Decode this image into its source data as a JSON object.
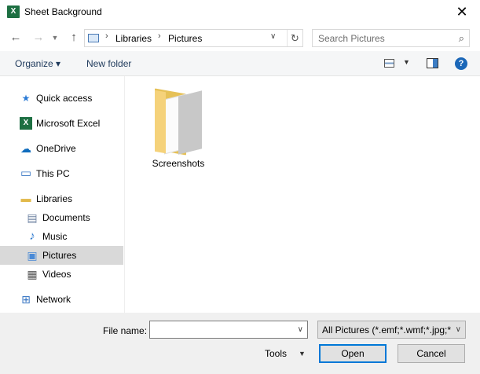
{
  "window": {
    "title": "Sheet Background",
    "app_icon_letter": "X",
    "close_glyph": "✕"
  },
  "navbar": {
    "back_glyph": "←",
    "forward_glyph": "→",
    "recent_glyph": "▼",
    "up_glyph": "↑",
    "breadcrumb": [
      "Libraries",
      "Pictures"
    ],
    "crumb_sep": "›",
    "dropdown_glyph": "∨",
    "refresh_glyph": "↻",
    "search_placeholder": "Search Pictures",
    "search_glyph": "⌕"
  },
  "toolbar": {
    "organize_label": "Organize ▾",
    "new_folder_label": "New folder",
    "view_drop_glyph": "▼",
    "help_glyph": "?"
  },
  "sidebar": {
    "items": [
      {
        "label": "Quick access",
        "icon": "star-icon",
        "glyph": "★",
        "color": "#2b7bd6"
      },
      {
        "label": "Microsoft Excel",
        "icon": "excel-icon",
        "glyph": "X",
        "color": "#1d6f42"
      },
      {
        "label": "OneDrive",
        "icon": "cloud-icon",
        "glyph": "☁",
        "color": "#0f6cbd"
      },
      {
        "label": "This PC",
        "icon": "computer-icon",
        "glyph": "▭",
        "color": "#3a77c4"
      },
      {
        "label": "Libraries",
        "icon": "libraries-icon",
        "glyph": "▬",
        "color": "#e2b94a"
      },
      {
        "label": "Documents",
        "icon": "document-icon",
        "glyph": "▤",
        "color": "#6a7fa0"
      },
      {
        "label": "Music",
        "icon": "music-icon",
        "glyph": "♪",
        "color": "#2f7ad0"
      },
      {
        "label": "Pictures",
        "icon": "picture-icon",
        "glyph": "▣",
        "color": "#4a8ad6"
      },
      {
        "label": "Videos",
        "icon": "video-icon",
        "glyph": "▦",
        "color": "#555555"
      },
      {
        "label": "Network",
        "icon": "network-icon",
        "glyph": "⊞",
        "color": "#3a77c4"
      }
    ],
    "selected": "Pictures"
  },
  "content": {
    "items": [
      {
        "name": "Screenshots",
        "type": "folder",
        "icon": "folder-icon"
      }
    ]
  },
  "footer": {
    "file_name_label": "File name:",
    "file_name_value": "",
    "filter_value": "All Pictures (*.emf;*.wmf;*.jpg;*",
    "tools_label": "Tools",
    "open_label": "Open",
    "cancel_label": "Cancel",
    "drop_glyph": "∨",
    "tools_drop_glyph": "▼"
  }
}
